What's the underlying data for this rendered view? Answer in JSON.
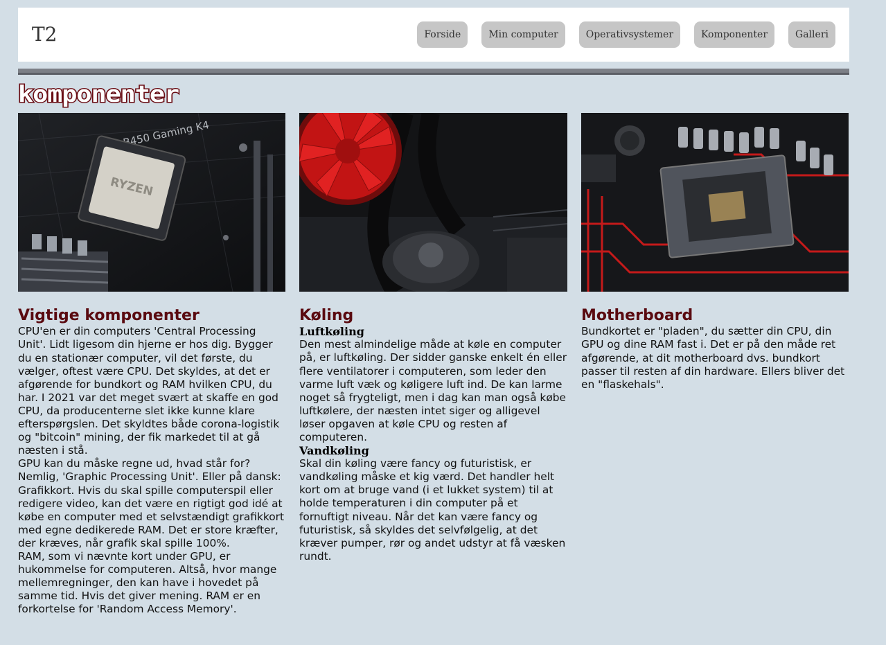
{
  "header": {
    "logo": "T2",
    "nav": [
      "Forside",
      "Min computer",
      "Operativsystemer",
      "Komponenter",
      "Galleri"
    ]
  },
  "page_logo_text": "komponenter",
  "columns": [
    {
      "title": "Vigtige komponenter",
      "paragraphs": [
        "CPU'en er din computers 'Central Processing Unit'. Lidt ligesom din hjerne er hos dig. Bygger du en stationær computer, vil det første, du vælger, oftest være CPU. Det skyldes, at det er afgørende for bundkort og RAM hvilken CPU, du har. I 2021 var det meget svært at skaffe en god CPU, da producenterne slet ikke kunne klare efterspørgslen. Det skyldtes både corona-logistik og \"bitcoin\" mining, der fik markedet til at gå næsten i stå.",
        "GPU kan du måske regne ud, hvad står for? Nemlig, 'Graphic Processing Unit'. Eller på dansk: Grafikkort. Hvis du skal spille computerspil eller redigere video, kan det være en rigtigt god idé at købe en computer med et selvstændigt grafikkort med egne dedikerede RAM. Det er store kræfter, der kræves, når grafik skal spille 100%.",
        "RAM, som vi nævnte kort under GPU, er hukommelse for computeren. Altså, hvor mange mellemregninger, den kan have i hovedet på samme tid. Hvis det giver mening. RAM er en forkortelse for 'Random Access Memory'."
      ]
    },
    {
      "title": "Køling",
      "sections": [
        {
          "subtitle": "Luftkøling",
          "text": "Den mest almindelige måde at køle en computer på, er luftkøling. Der sidder ganske enkelt én eller flere ventilatorer i computeren, som leder den varme luft væk og køligere luft ind. De kan larme noget så frygteligt, men i dag kan man også købe luftkølere, der næsten intet siger og alligevel løser opgaven at køle CPU og resten af computeren."
        },
        {
          "subtitle": "Vandkøling",
          "text": "Skal din køling være fancy og futuristisk, er vandkøling måske et kig værd. Det handler helt kort om at bruge vand (i et lukket system) til at holde temperaturen i din computer på et fornuftigt niveau. Når det kan være fancy og futuristisk, så skyldes det selvfølgelig, at det kræver pumper, rør og andet udstyr at få væsken rundt."
        }
      ]
    },
    {
      "title": "Motherboard",
      "paragraphs": [
        "Bundkortet er \"pladen\", du sætter din CPU, din GPU og dine RAM fast i. Det er på den måde ret afgørende, at dit motherboard dvs. bundkort passer til resten af din hardware. Ellers bliver det en \"flaskehals\"."
      ]
    }
  ],
  "images": {
    "cpu_label": "RYZEN",
    "board_label": "B450 Gaming K4"
  },
  "colors": {
    "background": "#d3dee6",
    "heading": "#5a0a10",
    "nav_button": "#c6c6c6",
    "divider": "#7c7f86",
    "accent_red": "#d01818"
  }
}
